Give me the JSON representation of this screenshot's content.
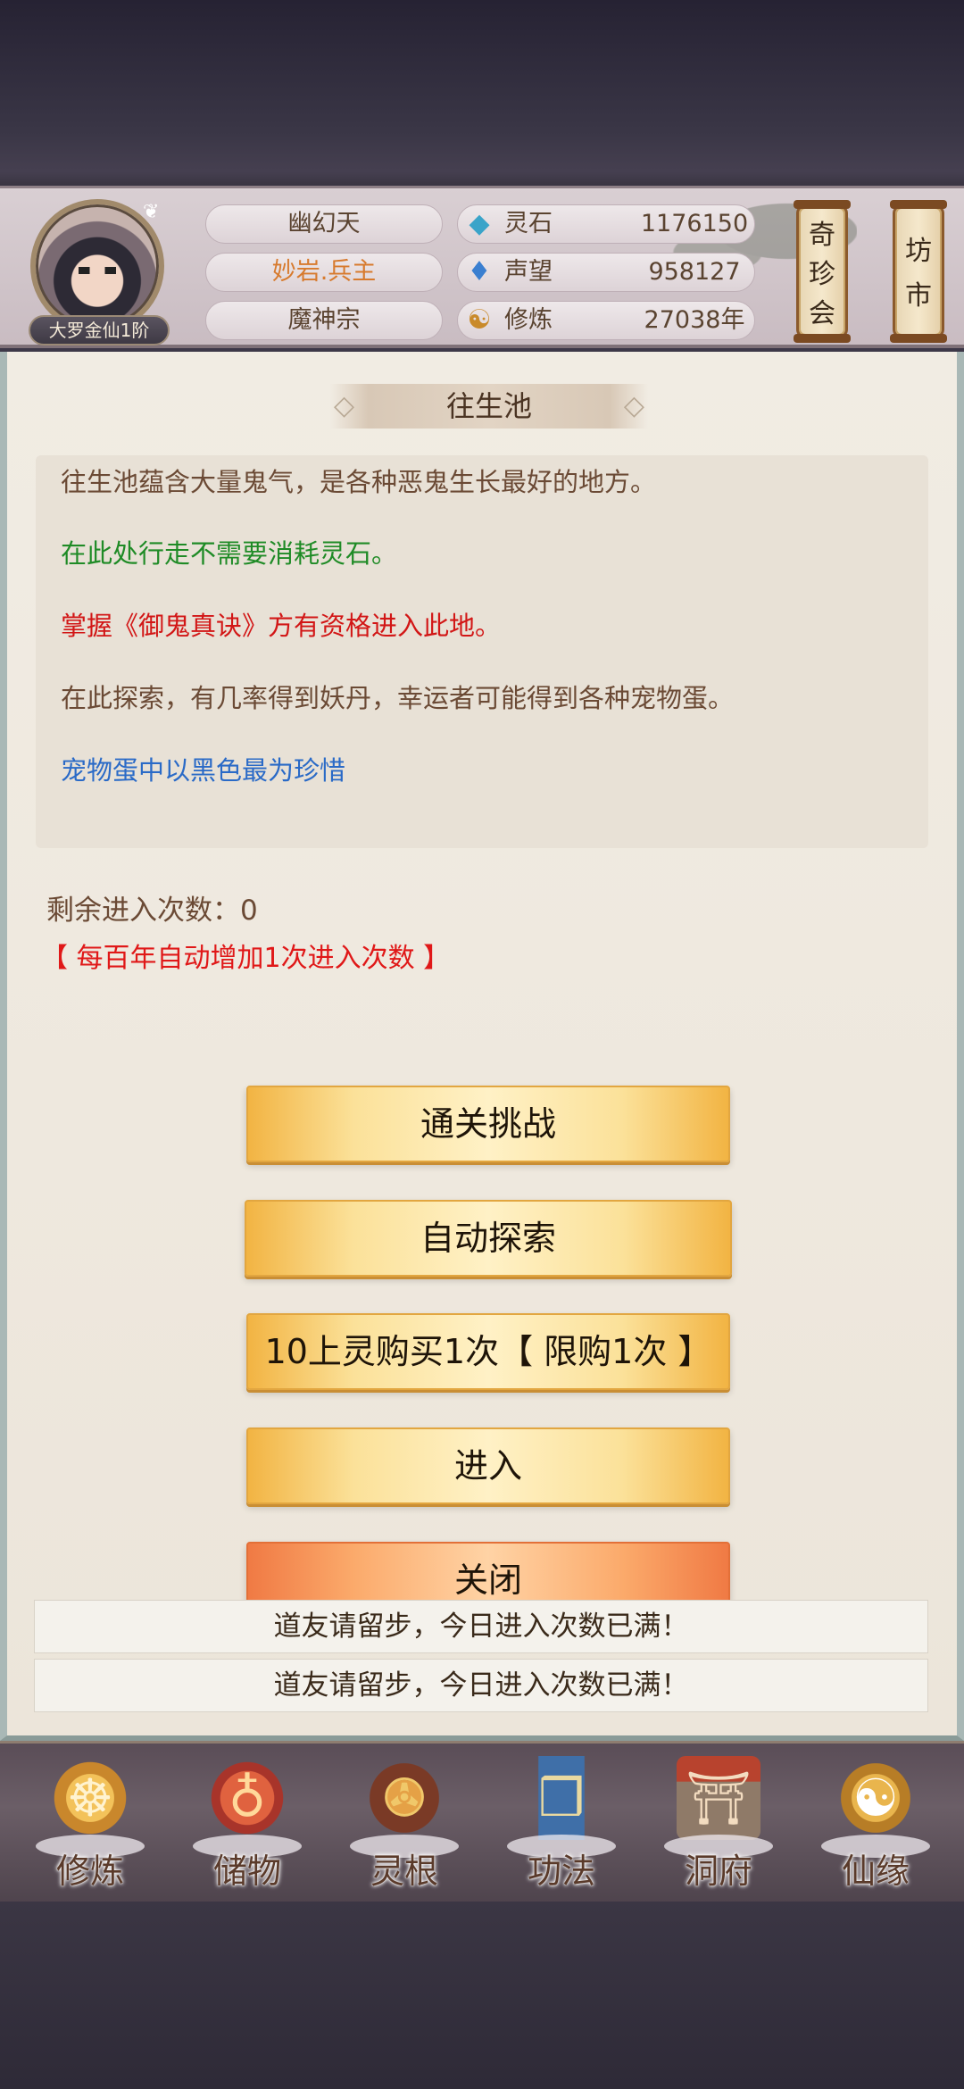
{
  "header": {
    "rank_badge": "大罗金仙1阶",
    "realm": "幽幻天",
    "player_name": "妙岩.兵主",
    "sect": "魔神宗",
    "stats": [
      {
        "icon": "spirit-stone-icon",
        "label": "灵石",
        "value": "1176150"
      },
      {
        "icon": "prestige-icon",
        "label": "声望",
        "value": "958127"
      },
      {
        "icon": "cultivation-icon",
        "label": "修炼",
        "value": "27038年"
      }
    ],
    "side_buttons": [
      "奇珍会",
      "坊市"
    ]
  },
  "panel": {
    "title": "往生池",
    "desc_lines": [
      {
        "text": "往生池蕴含大量鬼气，是各种恶鬼生长最好的地方。",
        "color": "#6b4a35"
      },
      {
        "text": "在此处行走不需要消耗灵石。",
        "color": "#1f8b26"
      },
      {
        "text": "掌握《御鬼真诀》方有资格进入此地。",
        "color": "#d21616"
      },
      {
        "text": "在此探索，有几率得到妖丹，幸运者可能得到各种宠物蛋。",
        "color": "#6b4a35"
      },
      {
        "text": "宠物蛋中以黑色最为珍惜",
        "color": "#2a6ac7"
      }
    ],
    "remaining": "剩余进入次数：0",
    "note": "【 每百年自动增加1次进入次数 】",
    "buttons": {
      "challenge": "通关挑战",
      "auto_explore": "自动探索",
      "buy": "10上灵购买1次【 限购1次 】",
      "enter": "进入",
      "close": "关闭"
    },
    "toasts": [
      "道友请留步，今日进入次数已满！",
      "道友请留步，今日进入次数已满！"
    ]
  },
  "nav": {
    "items": [
      {
        "label": "修炼",
        "icon": "cultivate-icon"
      },
      {
        "label": "储物",
        "icon": "storage-bag-icon"
      },
      {
        "label": "灵根",
        "icon": "spirit-root-icon"
      },
      {
        "label": "功法",
        "icon": "technique-book-icon"
      },
      {
        "label": "洞府",
        "icon": "cave-mansion-icon"
      },
      {
        "label": "仙缘",
        "icon": "immortal-fate-icon"
      }
    ]
  },
  "colors": {
    "accent_gold": "#f2b443",
    "close_orange": "#f07a44",
    "red_text": "#d21616",
    "green_text": "#1f8b26",
    "blue_text": "#2a6ac7"
  }
}
